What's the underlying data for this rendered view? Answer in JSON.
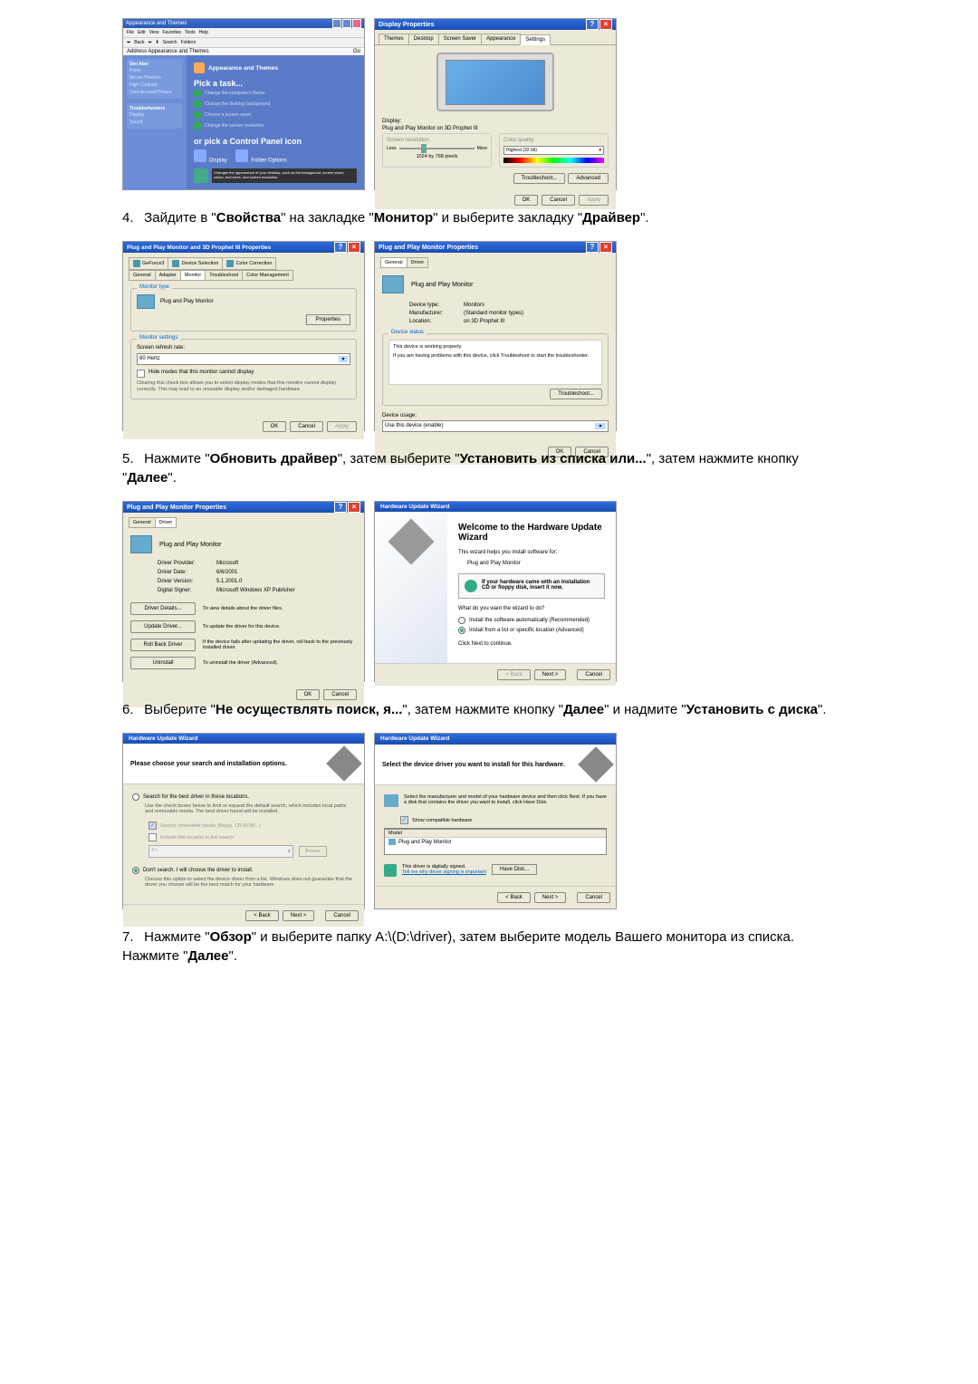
{
  "step4_text_pre": "Зайдите в \"",
  "step4_bold1": "Свойства",
  "step4_text_mid1": "\" на закладке \"",
  "step4_bold2": "Монитор",
  "step4_text_mid2": "\" и выберите закладку \"",
  "step4_bold3": "Драйвер",
  "step4_text_end": "\".",
  "step5_text_pre": "Нажмите \"",
  "step5_bold1": "Обновить драйвер",
  "step5_text_mid1": "\", затем выберите \"",
  "step5_bold2": "Установить из списка или...",
  "step5_text_mid2": "\", затем нажмите кнопку \"",
  "step5_bold3": "Далее",
  "step5_text_end": "\".",
  "step6_text_pre": "Выберите \"",
  "step6_bold1": "Не осуществлять поиск, я...",
  "step6_text_mid1": "\", затем нажмите кнопку \"",
  "step6_bold2": "Далее",
  "step6_text_mid2": "\" и надмите \"",
  "step6_bold3": "Установить с диска",
  "step6_text_end": "\".",
  "step7_text_pre": "Нажмите \"",
  "step7_bold1": "Обзор",
  "step7_text_mid1": "\" и выберите папку A:\\(D:\\driver), затем выберите модель Вашего монитора из списка. Нажмите \"",
  "step7_bold2": "Далее",
  "step7_text_end": "\".",
  "ss1": {
    "title": "Appearance and Themes",
    "menu": {
      "file": "File",
      "edit": "Edit",
      "view": "View",
      "favorites": "Favorites",
      "tools": "Tools",
      "help": "Help"
    },
    "toolbar": {
      "back": "Back",
      "search": "Search",
      "folders": "Folders"
    },
    "address": "Address Appearance and Themes",
    "go": "Go",
    "sidebar": {
      "see_also": "See Also",
      "items": [
        "Fonts",
        "Mouse Pointers",
        "High Contrast",
        "User Account Picture"
      ],
      "troubleshooters": "Troubleshooters",
      "titems": [
        "Display",
        "Sound"
      ]
    },
    "top_label": "Appearance and Themes",
    "pick_task": "Pick a task...",
    "tasks": [
      "Change the computer's theme",
      "Change the desktop background",
      "Choose a screen saver",
      "Change the screen resolution"
    ],
    "or_pick": "or pick a Control Panel icon",
    "cp_items": [
      "Display",
      "Folder Options"
    ],
    "desc": "Changes the appearance of your desktop, such as the background, screen saver, colors, font sizes, and screen resolution."
  },
  "ss2": {
    "title": "Display Properties",
    "tabs": [
      "Themes",
      "Desktop",
      "Screen Saver",
      "Appearance",
      "Settings"
    ],
    "display_label": "Display:",
    "display_name": "Plug and Play Monitor on 3D Prophet III",
    "screen_res": "Screen resolution",
    "less": "Less",
    "more": "More",
    "res_value": "1024 by 768 pixels",
    "color_quality": "Color quality",
    "color_value": "Highest (32 bit)",
    "troubleshoot": "Troubleshoot...",
    "advanced": "Advanced",
    "ok": "OK",
    "cancel": "Cancel",
    "apply": "Apply"
  },
  "ss3": {
    "title": "Plug and Play Monitor and 3D Prophet III Properties",
    "tabs_row1": [
      "GeForce3",
      "Device Selection",
      "Color Correction"
    ],
    "tabs_row2": [
      "General",
      "Adapter",
      "Monitor",
      "Troubleshoot",
      "Color Management"
    ],
    "monitor_type": "Monitor type",
    "monitor_name": "Plug and Play Monitor",
    "properties": "Properties",
    "monitor_settings": "Monitor settings",
    "refresh_label": "Screen refresh rate:",
    "refresh_value": "60 Hertz",
    "hide_modes": "Hide modes that this monitor cannot display",
    "hide_desc": "Clearing this check box allows you to select display modes that this monitor cannot display correctly. This may lead to an unusable display and/or damaged hardware.",
    "ok": "OK",
    "cancel": "Cancel",
    "apply": "Apply"
  },
  "ss4": {
    "title": "Plug and Play Monitor Properties",
    "tabs": [
      "General",
      "Driver"
    ],
    "name": "Plug and Play Monitor",
    "devtype_label": "Device type:",
    "devtype": "Monitors",
    "manuf_label": "Manufacturer:",
    "manuf": "(Standard monitor types)",
    "loc_label": "Location:",
    "loc": "on 3D Prophet III",
    "status_title": "Device status",
    "status_line1": "This device is working properly.",
    "status_line2": "If you are having problems with this device, click Troubleshoot to start the troubleshooter.",
    "troubleshoot": "Troubleshoot...",
    "usage_label": "Device usage:",
    "usage_value": "Use this device (enable)",
    "ok": "OK",
    "cancel": "Cancel"
  },
  "ss5": {
    "title": "Plug and Play Monitor Properties",
    "tabs": [
      "General",
      "Driver"
    ],
    "name": "Plug and Play Monitor",
    "provider_label": "Driver Provider:",
    "provider": "Microsoft",
    "date_label": "Driver Date:",
    "date": "6/6/2001",
    "version_label": "Driver Version:",
    "version": "5.1.2001.0",
    "signer_label": "Digital Signer:",
    "signer": "Microsoft Windows XP Publisher",
    "btn_details": "Driver Details...",
    "btn_details_desc": "To view details about the driver files.",
    "btn_update": "Update Driver...",
    "btn_update_desc": "To update the driver for this device.",
    "btn_rollback": "Roll Back Driver",
    "btn_rollback_desc": "If the device fails after updating the driver, roll back to the previously installed driver.",
    "btn_uninstall": "Uninstall",
    "btn_uninstall_desc": "To uninstall the driver (Advanced).",
    "ok": "OK",
    "cancel": "Cancel"
  },
  "ss6": {
    "title": "Hardware Update Wizard",
    "welcome": "Welcome to the Hardware Update Wizard",
    "intro": "This wizard helps you install software for:",
    "device": "Plug and Play Monitor",
    "cd_text": "If your hardware came with an installation CD or floppy disk, insert it now.",
    "what": "What do you want the wizard to do?",
    "opt1": "Install the software automatically (Recommended)",
    "opt2": "Install from a list or specific location (Advanced)",
    "click_next": "Click Next to continue.",
    "back": "< Back",
    "next": "Next >",
    "cancel": "Cancel"
  },
  "ss7": {
    "title": "Hardware Update Wizard",
    "header": "Please choose your search and installation options.",
    "opt1": "Search for the best driver in these locations.",
    "opt1_desc": "Use the check boxes below to limit or expand the default search, which includes local paths and removable media. The best driver found will be installed.",
    "cb1": "Search removable media (floppy, CD-ROM...)",
    "cb2": "Include this location in the search:",
    "path": "A:\\",
    "browse": "Browse",
    "opt2": "Don't search. I will choose the driver to install.",
    "opt2_desc": "Choose this option to select the device driver from a list. Windows does not guarantee that the driver you choose will be the best match for your hardware.",
    "back": "< Back",
    "next": "Next >",
    "cancel": "Cancel"
  },
  "ss8": {
    "title": "Hardware Update Wizard",
    "header": "Select the device driver you want to install for this hardware.",
    "info": "Select the manufacturer and model of your hardware device and then click Next. If you have a disk that contains the driver you want to install, click Have Disk.",
    "show_compat": "Show compatible hardware",
    "model_col": "Model",
    "model_item": "Plug and Play Monitor",
    "signed": "This driver is digitally signed.",
    "signed_link": "Tell me why driver signing is important",
    "have_disk": "Have Disk...",
    "back": "< Back",
    "next": "Next >",
    "cancel": "Cancel"
  }
}
